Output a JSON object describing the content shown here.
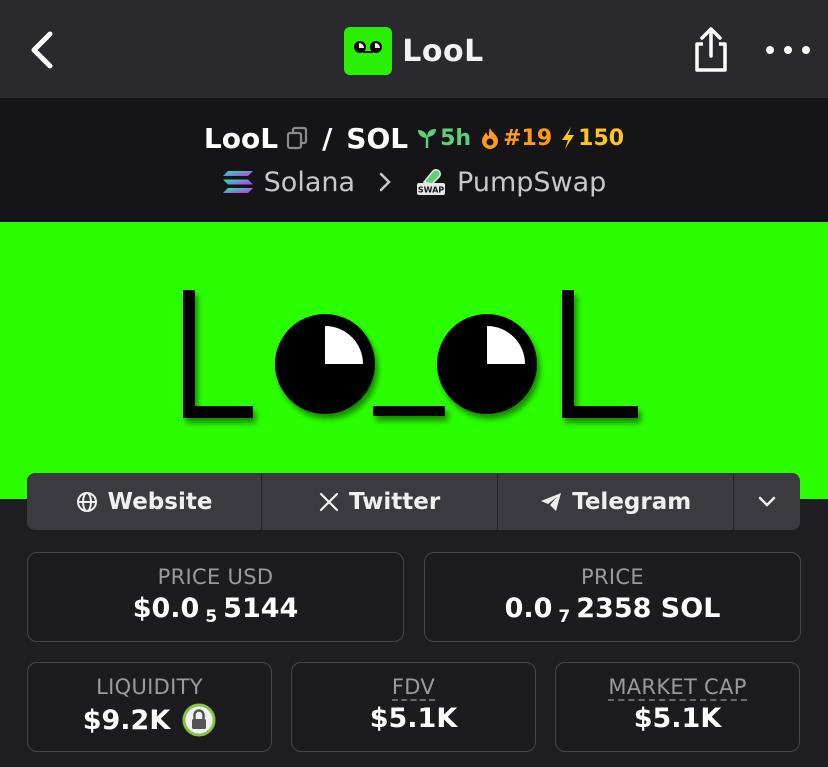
{
  "header": {
    "app_title": "LooL",
    "back_icon": "chevron-left-icon",
    "share_icon": "share-icon",
    "more_icon": "more-dots-icon",
    "logo_color": "#29f000"
  },
  "pair": {
    "base": "LooL",
    "separator": "/",
    "quote": "SOL",
    "age": "5h",
    "rank": "#19",
    "boosts": "150",
    "chain": "Solana",
    "dex": "PumpSwap",
    "dex_badge": "SWAP"
  },
  "banner": {
    "text": "LooL",
    "background": "#2aff00"
  },
  "links": {
    "website": "Website",
    "twitter": "Twitter",
    "telegram": "Telegram"
  },
  "stats": {
    "price_usd": {
      "label": "PRICE USD",
      "prefix": "$0.0",
      "sub": "5",
      "suffix": "5144"
    },
    "price_native": {
      "label": "PRICE",
      "prefix": "0.0",
      "sub": "7",
      "suffix": "2358 SOL"
    },
    "liquidity": {
      "label": "LIQUIDITY",
      "value": "$9.2K"
    },
    "fdv": {
      "label": "FDV",
      "value": "$5.1K"
    },
    "market_cap": {
      "label": "MARKET CAP",
      "value": "$5.1K"
    }
  }
}
